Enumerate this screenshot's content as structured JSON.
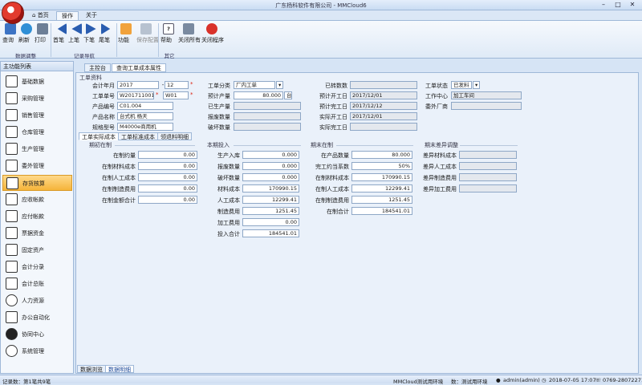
{
  "window": {
    "title": "广东杨科软件有限公司 - MMCloud6"
  },
  "menu_tabs": [
    "首页",
    "操作",
    "关于"
  ],
  "ribbon": {
    "buttons": [
      "查询",
      "刷新",
      "打印",
      "首笔",
      "上笔",
      "下笔",
      "尾笔",
      "功能",
      "保存配置",
      "帮助",
      "关闭所有",
      "关闭程序"
    ],
    "groups": [
      "数据调整",
      "记录导航",
      "其它"
    ]
  },
  "left_panel": {
    "title": "主功能列表",
    "items": [
      "基础数据",
      "采购管理",
      "销售管理",
      "仓库管理",
      "生产管理",
      "委外管理",
      "存货核算",
      "应收帐款",
      "应付帐款",
      "票据资金",
      "固定资产",
      "会计分录",
      "会计总账",
      "人力资源",
      "办公自动化",
      "协同中心",
      "系统管理"
    ]
  },
  "doc_tabs": [
    "主控台",
    "查询工单成本属性"
  ],
  "form": {
    "section": "工单资料",
    "fields": {
      "year_month_label": "会计年月",
      "year": "2017",
      "dash": "-",
      "month": "12",
      "order_no_label": "工单单号",
      "order_no": "W2017110011",
      "order_suffix": "W01",
      "product_no_label": "产品编号",
      "product_no": "C01.004",
      "product_name_label": "产品名称",
      "product_name": "台式机 杨天",
      "spec_label": "规格型号",
      "spec": "M4000e商用机",
      "type_label": "工单分类",
      "type": "厂内工单",
      "plan_qty_label": "预计产量",
      "plan_qty": "80.000",
      "unit": "台",
      "produced_label": "已生产量",
      "produced": "",
      "scrap_label": "报废数量",
      "scrap": "",
      "damage_label": "破坏数量",
      "damage": "",
      "transfer_label": "已转数数",
      "transfer": "",
      "plan_start_label": "预计开工日",
      "plan_start": "2017/12/01",
      "plan_finish_label": "预计完工日",
      "plan_finish": "2017/12/12",
      "actual_start_label": "实际开工日",
      "actual_start": "2017/12/01",
      "actual_finish_label": "实际完工日",
      "actual_finish": "",
      "status_label": "工单状态",
      "status": "已发料",
      "center_label": "工作中心",
      "center": "加工车间",
      "vendor_label": "委外厂商",
      "vendor": ""
    },
    "sub_tabs": [
      "工单实际成本",
      "工单标准成本",
      "领退料明细"
    ],
    "opening": {
      "title": "期初在制",
      "rows": [
        {
          "label": "在制约量",
          "value": "0.00"
        },
        {
          "label": "在制材料成本",
          "value": "0.00"
        },
        {
          "label": "在制人工成本",
          "value": "0.00"
        },
        {
          "label": "在制制造费用",
          "value": "0.00"
        },
        {
          "label": "在制金额合计",
          "value": "0.00"
        }
      ]
    },
    "period_input": {
      "title": "本期投入",
      "rows": [
        {
          "label": "生产入库",
          "value": "0.000"
        },
        {
          "label": "报废数量",
          "value": "0.000"
        },
        {
          "label": "破坏数量",
          "value": "0.000"
        },
        {
          "label": "材料成本",
          "value": "170990.15"
        },
        {
          "label": "人工成本",
          "value": "12299.41"
        },
        {
          "label": "制造费用",
          "value": "1251.45"
        },
        {
          "label": "加工费用",
          "value": "0.00"
        },
        {
          "label": "投入合计",
          "value": "184541.01"
        }
      ]
    },
    "ending": {
      "title": "期末在制",
      "rows": [
        {
          "label": "在产品数量",
          "value": "80.000"
        },
        {
          "label": "完工约当系数",
          "value": "50%"
        },
        {
          "label": "在制材料成本",
          "value": "170990.15"
        },
        {
          "label": "在制人工成本",
          "value": "12299.41"
        },
        {
          "label": "在制制造费用",
          "value": "1251.45"
        },
        {
          "label": "在制合计",
          "value": "184541.01"
        }
      ]
    },
    "variance": {
      "title": "期末差异调整",
      "rows": [
        {
          "label": "差异材料成本",
          "value": ""
        },
        {
          "label": "差异人工成本",
          "value": ""
        },
        {
          "label": "差异制造费用",
          "value": ""
        },
        {
          "label": "差异加工费用",
          "value": ""
        }
      ]
    }
  },
  "bottom_tabs": [
    "数据浏览",
    "数据明细"
  ],
  "status": {
    "records": "记录数：第1笔共9笔",
    "env": "MMCloud测试用环境",
    "db": "数：测试用环境",
    "user": "admin(admin)",
    "datetime": "2018-07-05 17:07",
    "phone": "0769-28072271"
  },
  "colors": {
    "accent": "#f5b43a",
    "frame": "#9fb8d8"
  }
}
